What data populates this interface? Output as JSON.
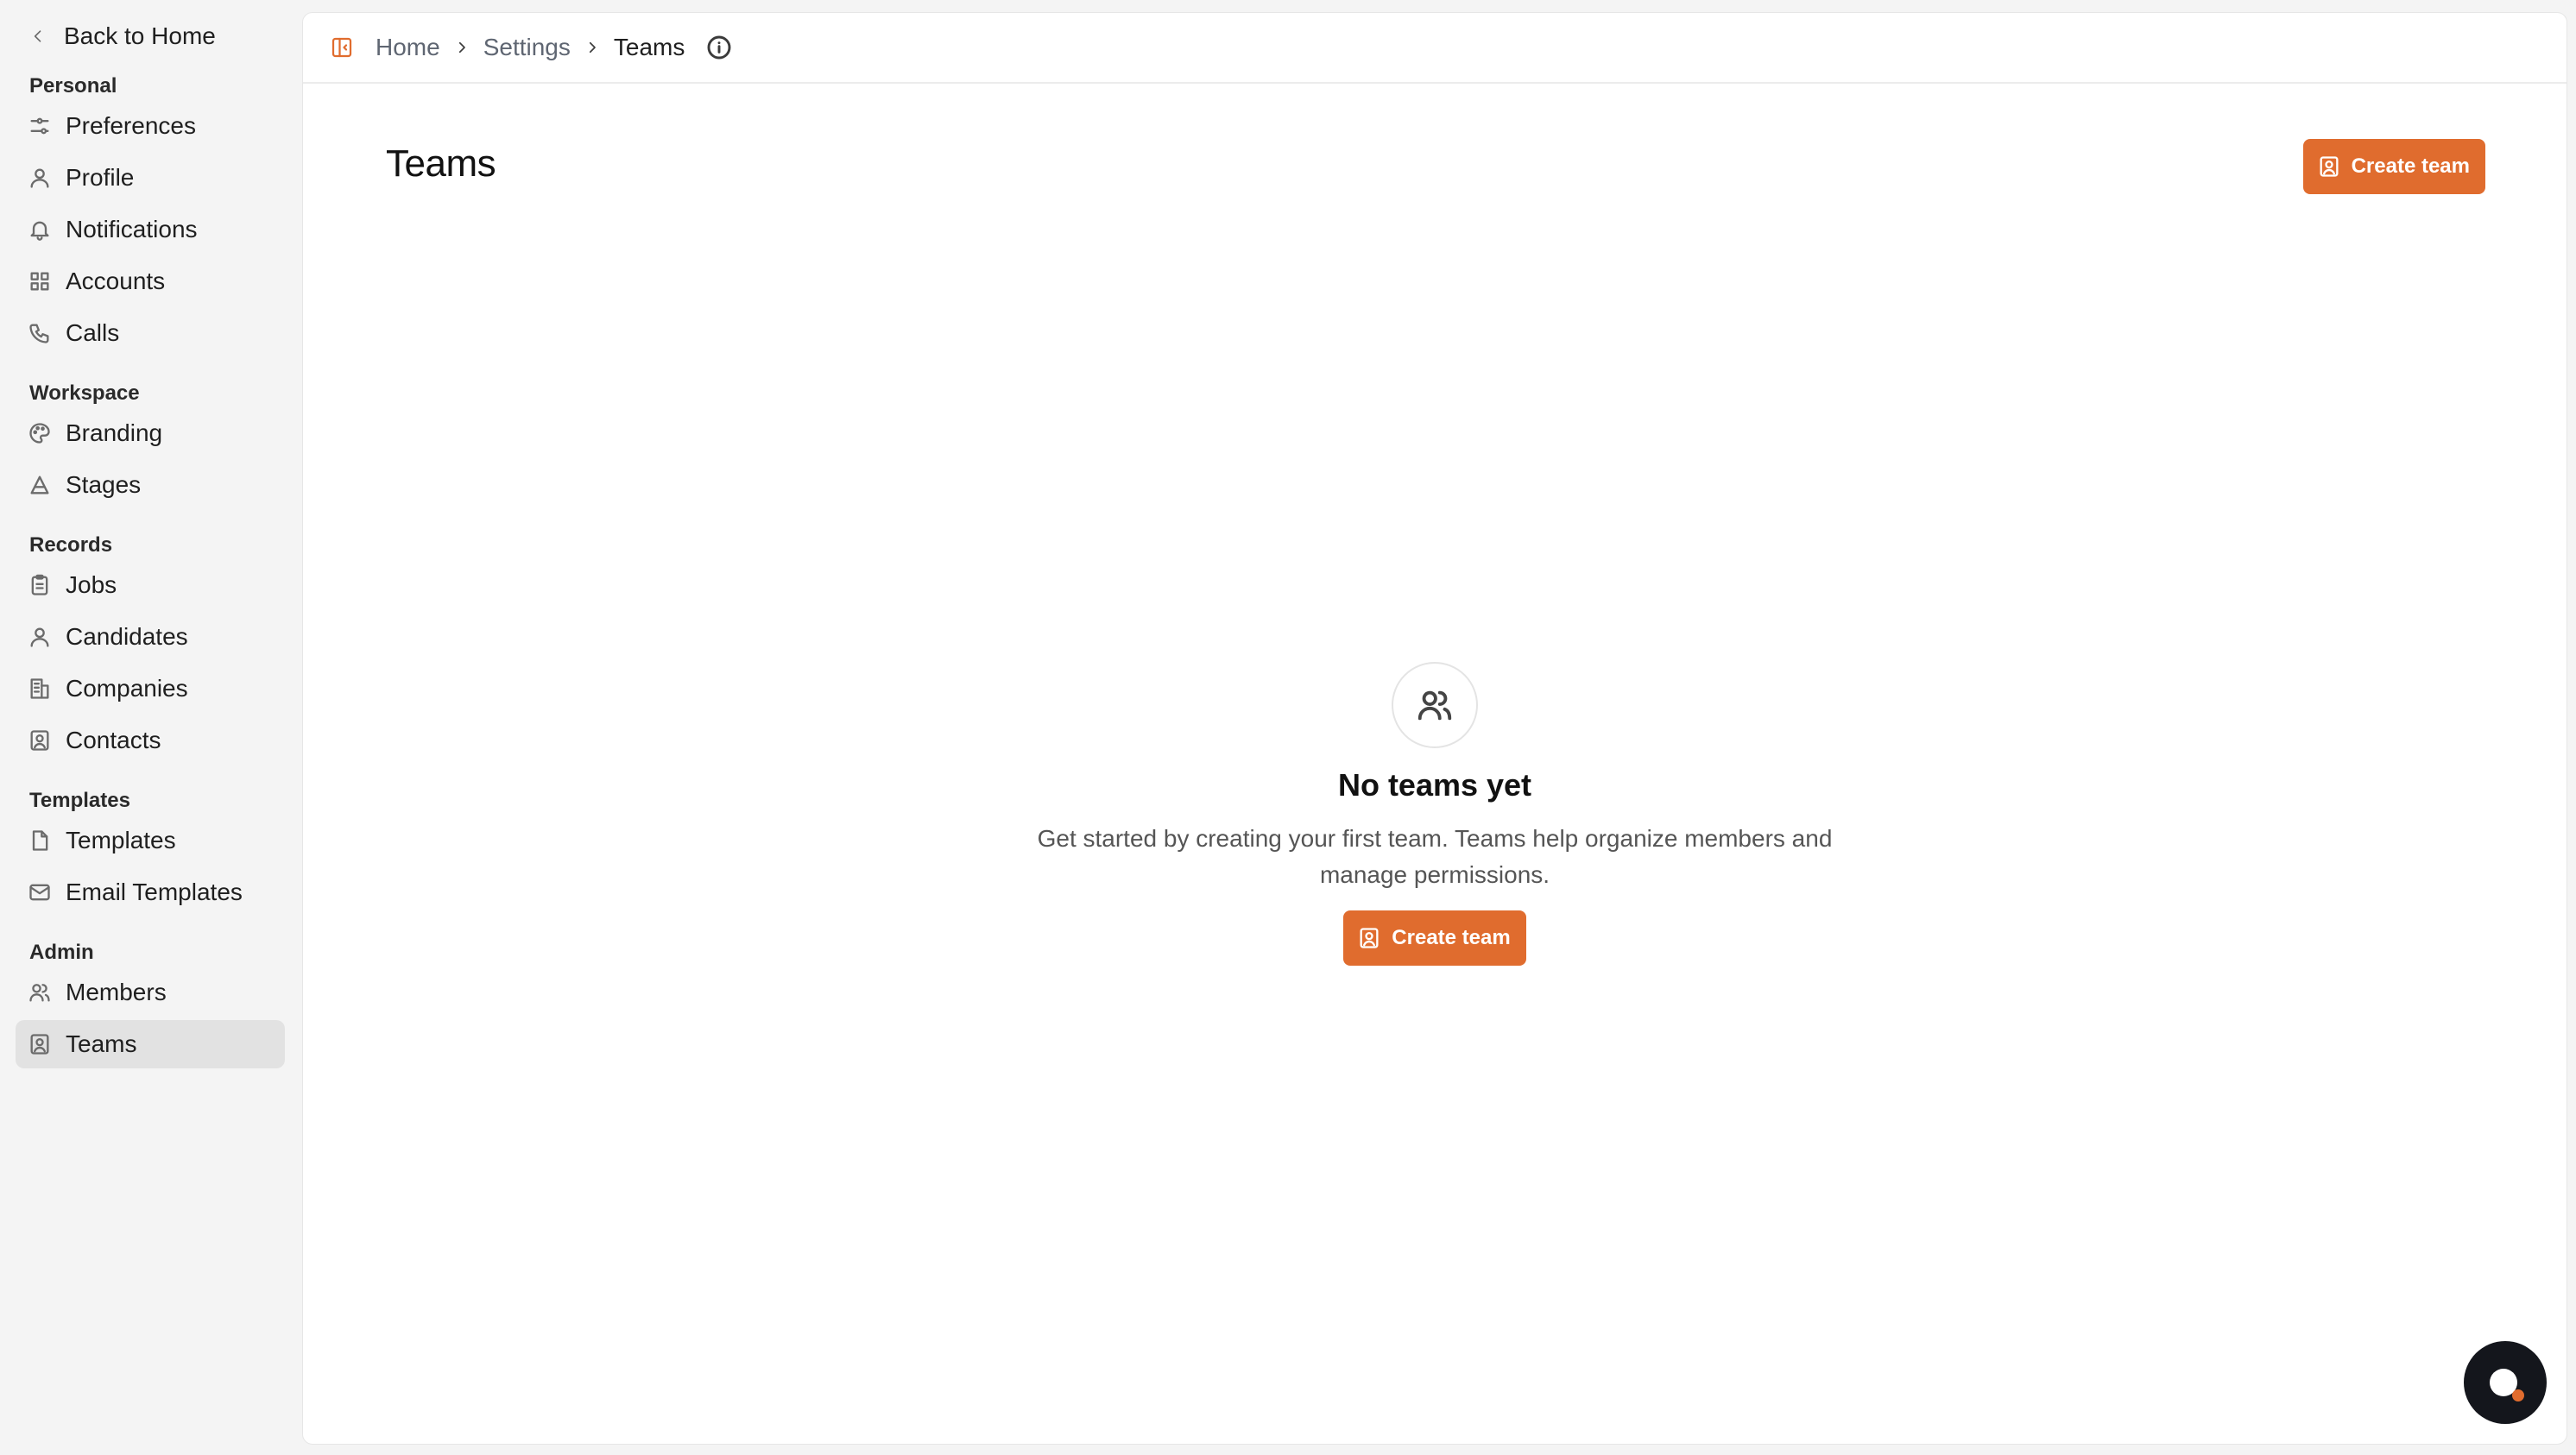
{
  "sidebar": {
    "back_label": "Back to Home",
    "sections": [
      {
        "title": "Personal",
        "items": [
          {
            "label": "Preferences",
            "icon": "sliders-icon"
          },
          {
            "label": "Profile",
            "icon": "user-icon"
          },
          {
            "label": "Notifications",
            "icon": "bell-icon"
          },
          {
            "label": "Accounts",
            "icon": "grid-icon"
          },
          {
            "label": "Calls",
            "icon": "phone-icon"
          }
        ]
      },
      {
        "title": "Workspace",
        "items": [
          {
            "label": "Branding",
            "icon": "palette-icon"
          },
          {
            "label": "Stages",
            "icon": "triangle-icon"
          }
        ]
      },
      {
        "title": "Records",
        "items": [
          {
            "label": "Jobs",
            "icon": "clipboard-icon"
          },
          {
            "label": "Candidates",
            "icon": "user-icon"
          },
          {
            "label": "Companies",
            "icon": "building-icon"
          },
          {
            "label": "Contacts",
            "icon": "contact-icon"
          }
        ]
      },
      {
        "title": "Templates",
        "items": [
          {
            "label": "Templates",
            "icon": "file-icon"
          },
          {
            "label": "Email Templates",
            "icon": "mail-icon"
          }
        ]
      },
      {
        "title": "Admin",
        "items": [
          {
            "label": "Members",
            "icon": "users-icon"
          },
          {
            "label": "Teams",
            "icon": "contact-icon",
            "active": true
          }
        ]
      }
    ]
  },
  "breadcrumb": {
    "items": [
      "Home",
      "Settings",
      "Teams"
    ]
  },
  "page": {
    "title": "Teams",
    "create_button": "Create team"
  },
  "empty_state": {
    "title": "No teams yet",
    "description": "Get started by creating your first team. Teams help organize members and manage permissions.",
    "button": "Create team"
  },
  "colors": {
    "accent": "#e06c2e",
    "active_bg": "#e2e2e2",
    "chat_bg": "#14161c"
  }
}
